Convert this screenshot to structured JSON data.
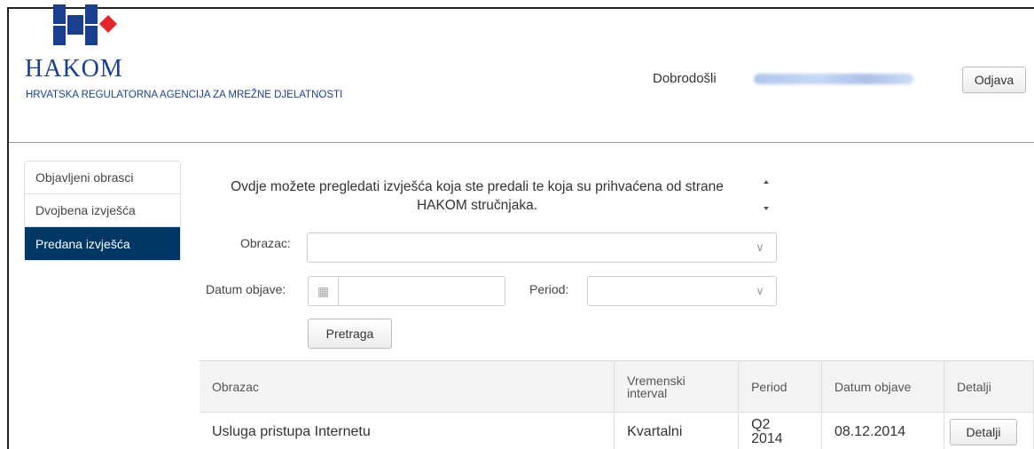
{
  "brand": {
    "logo_text": "HAKOM",
    "logo_subtitle": "HRVATSKA REGULATORNA AGENCIJA ZA MREŽNE DJELATNOSTI",
    "colors": {
      "blue": "#1b3f8f",
      "red": "#e3262c",
      "navy": "#003764"
    }
  },
  "header": {
    "welcome": "Dobrodošli",
    "logout_label": "Odjava"
  },
  "sidebar": {
    "items": [
      {
        "label": "Objavljeni obrasci"
      },
      {
        "label": "Dvojbena izvješća"
      },
      {
        "label": "Predana izvješća"
      }
    ]
  },
  "main": {
    "intro": "Ovdje možete pregledati izvješća koja ste predali te koja su prihvaćena od strane HAKOM stručnjaka.",
    "form_label": "Obrazac:",
    "form_value": "",
    "date_label": "Datum objave:",
    "date_value": "",
    "period_label": "Period:",
    "period_value": "",
    "search_label": "Pretraga"
  },
  "table": {
    "headers": [
      "Obrazac",
      "Vremenski interval",
      "Period",
      "Datum objave",
      "Detalji"
    ],
    "rows": [
      {
        "form": "Usluga pristupa Internetu",
        "interval": "Kvartalni",
        "period": "Q2 2014",
        "date": "08.12.2014",
        "details_label": "Detalji"
      }
    ]
  }
}
